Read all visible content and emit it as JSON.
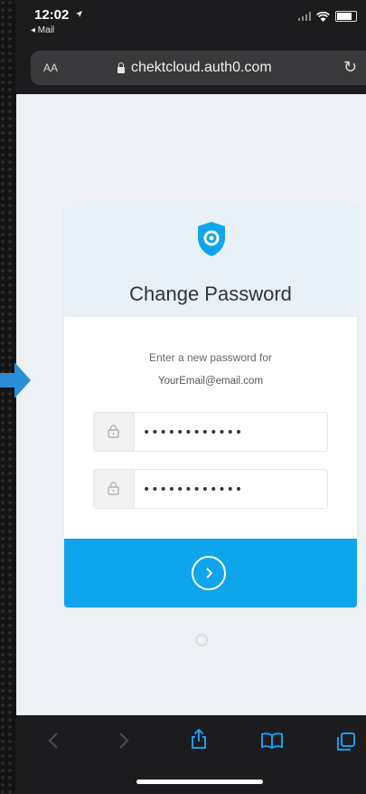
{
  "status_bar": {
    "time": "12:02",
    "back_app": "◂ Mail"
  },
  "browser": {
    "text_size_label": "AA",
    "url": "chektcloud.auth0.com"
  },
  "card": {
    "title": "Change Password",
    "instruction": "Enter a new password for",
    "email": "YourEmail@email.com",
    "password_value": "••••••••••••",
    "confirm_password_value": "••••••••••••"
  },
  "colors": {
    "accent": "#0ea5ec",
    "header_bg": "#e8f1f8",
    "page_bg": "#eef1f5",
    "browser_chrome": "#1c1c1e"
  },
  "icons": {
    "logo": "shield-logo-icon",
    "field": "lock-icon",
    "submit": "chevron-right-icon",
    "toolbar": [
      "back-icon",
      "forward-icon",
      "share-icon",
      "bookmarks-icon",
      "tabs-icon"
    ]
  }
}
